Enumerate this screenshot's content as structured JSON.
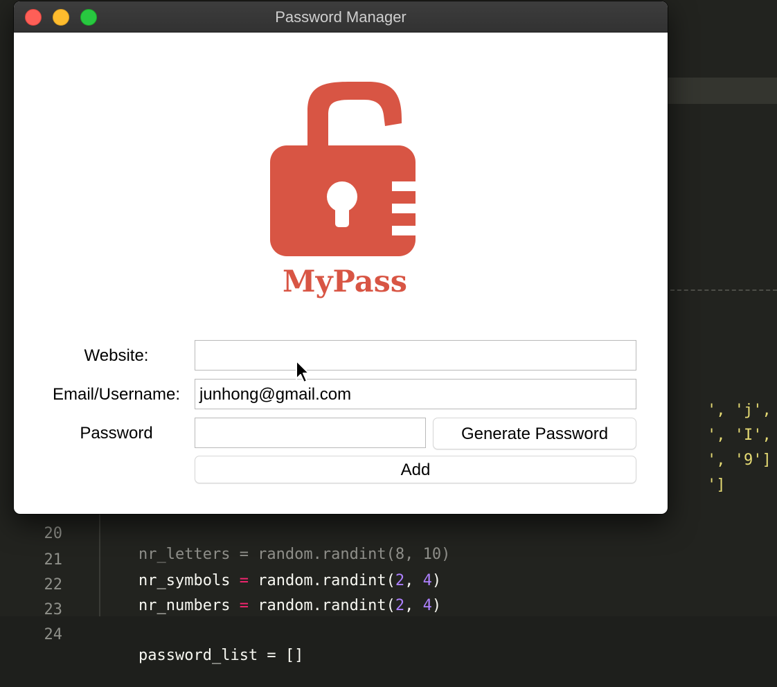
{
  "window": {
    "title": "Password Manager"
  },
  "logo": {
    "text": "MyPass"
  },
  "form": {
    "website": {
      "label": "Website:",
      "value": ""
    },
    "email": {
      "label": "Email/Username:",
      "value": "junhong@gmail.com"
    },
    "password": {
      "label": "Password",
      "value": ""
    },
    "generate_button": "Generate Password",
    "add_button": "Add"
  },
  "editor": {
    "lines": [
      {
        "number": "21",
        "var": "nr_symbols",
        "op": "=",
        "call": "random.randint(",
        "a": "2",
        "sep": ", ",
        "b": "4",
        "close": ")"
      },
      {
        "number": "22",
        "var": "nr_numbers",
        "op": "=",
        "call": "random.randint(",
        "a": "2",
        "sep": ", ",
        "b": "4",
        "close": ")"
      },
      {
        "number": "23"
      }
    ],
    "partial_line_20": {
      "number": "20",
      "text": "nr_letters = random.randint(8, 10)"
    },
    "partial_line_24": {
      "number": "24",
      "text": "password_list = []"
    },
    "right_fragments": [
      "', 'j', 'k'",
      "', 'I', 'J'",
      "', '9']",
      "']"
    ]
  },
  "colors": {
    "brand_red": "#d85544",
    "titlebar": "#363636",
    "editor_bg": "#22231f"
  }
}
